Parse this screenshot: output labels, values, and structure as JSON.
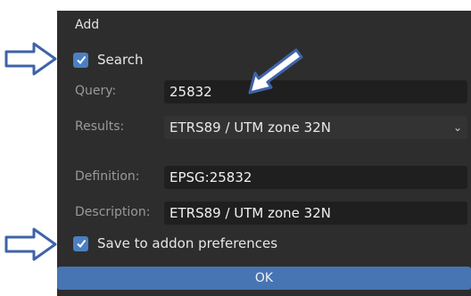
{
  "dialog": {
    "title": "Add",
    "search_checkbox": {
      "label": "Search",
      "checked": true
    },
    "query": {
      "label": "Query:",
      "value": "25832"
    },
    "results": {
      "label": "Results:",
      "value": "ETRS89 / UTM zone 32N"
    },
    "definition": {
      "label": "Definition:",
      "value": "EPSG:25832"
    },
    "description": {
      "label": "Description:",
      "value": "ETRS89 / UTM zone 32N"
    },
    "save_checkbox": {
      "label": "Save to addon preferences",
      "checked": true
    },
    "ok_label": "OK"
  },
  "icons": {
    "checkmark": "check-icon",
    "dropdown": "chevron-down-icon",
    "annotation_arrow": "arrow-icon"
  },
  "colors": {
    "dialog_bg": "#2d2d2d",
    "checkbox": "#4a7fc2",
    "ok_button": "#4774b3",
    "annotation_arrow": "#3f63a8"
  }
}
